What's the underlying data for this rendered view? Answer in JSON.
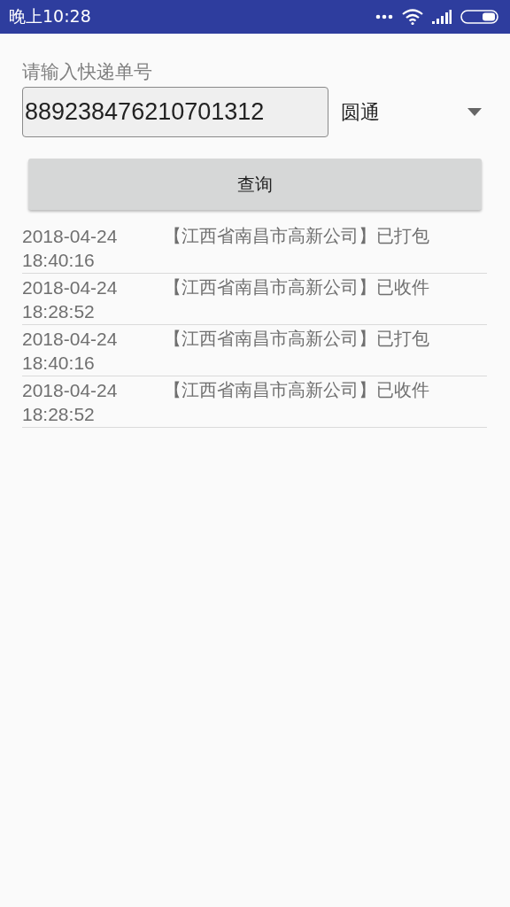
{
  "status_bar": {
    "time": "晚上10:28"
  },
  "form": {
    "label": "请输入快递单号",
    "tracking_number": "889238476210701312",
    "carrier": "圆通",
    "query_button": "查询"
  },
  "records": [
    {
      "time": "2018-04-24 18:40:16",
      "event": "【江西省南昌市高新公司】已打包"
    },
    {
      "time": "2018-04-24 18:28:52",
      "event": "【江西省南昌市高新公司】已收件"
    },
    {
      "time": "2018-04-24 18:40:16",
      "event": "【江西省南昌市高新公司】已打包"
    },
    {
      "time": "2018-04-24 18:28:52",
      "event": "【江西省南昌市高新公司】已收件"
    }
  ]
}
